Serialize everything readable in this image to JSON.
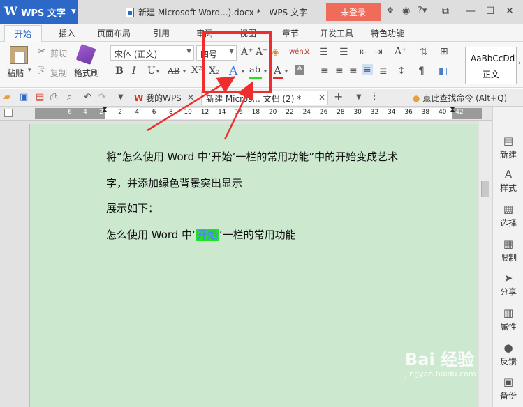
{
  "app": {
    "name": "WPS 文字",
    "logo": "W",
    "doc_title": "新建 Microsoft Word...).docx * - WPS 文字",
    "login": "未登录"
  },
  "tabs": [
    "开始",
    "插入",
    "页面布局",
    "引用",
    "审阅",
    "视图",
    "章节",
    "开发工具",
    "特色功能"
  ],
  "ribbon": {
    "paste": "粘贴",
    "cut": "剪切",
    "copy": "复制",
    "format_painter": "格式刷",
    "font_name": "宋体 (正文)",
    "font_size": "四号",
    "wen": "wén文",
    "style_preview": "AaBbCcDd",
    "style_name": "正文"
  },
  "qbar": {
    "tab_home": "我的WPS",
    "tab_doc": "新建 Micros... 文档 (2) *",
    "search": "点此查找命令 (Alt+Q)"
  },
  "ruler": {
    "left_ticks": [
      "6",
      "4",
      "2"
    ],
    "right_ticks": [
      "2",
      "4",
      "6",
      "8",
      "10",
      "12",
      "14",
      "16",
      "18",
      "20",
      "22",
      "24",
      "26",
      "28",
      "30",
      "32",
      "34",
      "36",
      "38",
      "40",
      "42"
    ]
  },
  "document": {
    "line1": "将“怎么使用 Word 中‘开始’一栏的常用功能”中的开始变成艺术",
    "line2": "字，并添加绿色背景突出显示",
    "line3": "展示如下：",
    "line4_before": "怎么使用 Word 中‘",
    "line4_highlight": "开始",
    "line4_after": "’一栏的常用功能"
  },
  "right_pane": [
    "新建",
    "样式",
    "选择",
    "限制",
    "分享",
    "属性",
    "反馈",
    "备份"
  ],
  "watermark": {
    "brand": "Bai 经验",
    "url": "jingyan.baidu.com"
  },
  "colors": {
    "title_blue": "#2b68c7",
    "login_red": "#ef6b5a",
    "annotation_red": "#ee2d2d",
    "page_green": "#cce8cf",
    "highlight_green": "#22e322",
    "highlight_text": "#4a8ce6"
  }
}
